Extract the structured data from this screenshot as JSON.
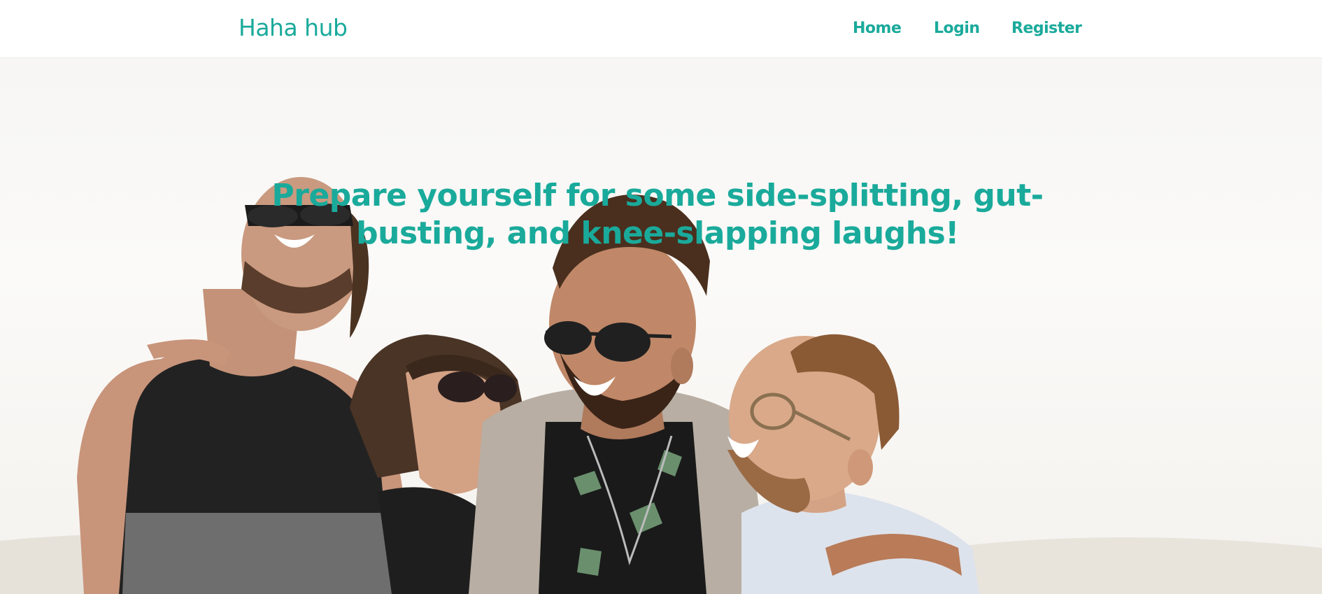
{
  "nav": {
    "brand": "Haha hub",
    "links": [
      {
        "label": "Home"
      },
      {
        "label": "Login"
      },
      {
        "label": "Register"
      }
    ]
  },
  "hero": {
    "headline": "Prepare yourself for some side-splitting, gut-busting, and knee-slapping laughs!",
    "image_subject": "four-friends-laughing-photo"
  },
  "colors": {
    "accent": "#1aaa9b",
    "nav_background": "#ffffff",
    "hero_background": "#f7f6f4"
  }
}
